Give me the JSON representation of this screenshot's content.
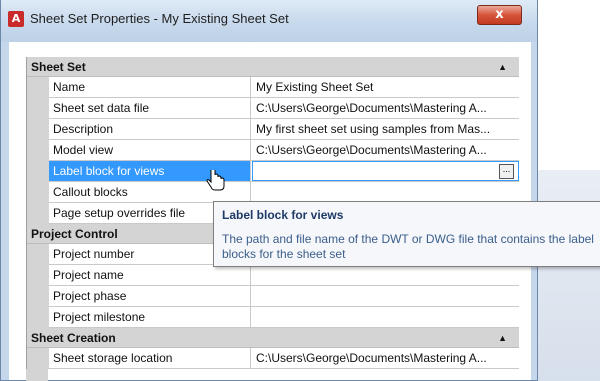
{
  "window": {
    "title": "Sheet Set Properties - My Existing Sheet Set",
    "close_label": "x"
  },
  "categories": [
    {
      "label": "Sheet Set",
      "rows": [
        {
          "name": "Name",
          "value": "My Existing Sheet Set"
        },
        {
          "name": "Sheet set data file",
          "value": "C:\\Users\\George\\Documents\\Mastering A..."
        },
        {
          "name": "Description",
          "value": "My first sheet set using samples from Mas..."
        },
        {
          "name": "Model view",
          "value": "C:\\Users\\George\\Documents\\Mastering A..."
        },
        {
          "name": "Label block for views",
          "value": "",
          "selected": true
        },
        {
          "name": "Callout blocks",
          "value": ""
        },
        {
          "name": "Page setup overrides file",
          "value": ""
        }
      ]
    },
    {
      "label": "Project Control",
      "rows": [
        {
          "name": "Project number",
          "value": ""
        },
        {
          "name": "Project name",
          "value": ""
        },
        {
          "name": "Project phase",
          "value": ""
        },
        {
          "name": "Project milestone",
          "value": ""
        }
      ]
    },
    {
      "label": "Sheet Creation",
      "rows": [
        {
          "name": "Sheet storage location",
          "value": "C:\\Users\\George\\Documents\\Mastering A..."
        }
      ]
    }
  ],
  "ellipsis_label": "...",
  "tooltip": {
    "title": "Label block for views",
    "body": "The path and file name of the DWT or DWG file that contains the label blocks for the sheet set"
  },
  "colors": {
    "selection": "#3399ff",
    "category_bg": "#d4d4d4",
    "close_button": "#c23b21"
  }
}
